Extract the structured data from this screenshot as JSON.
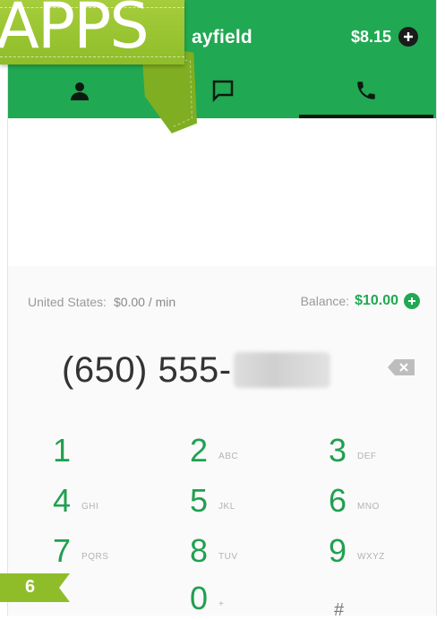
{
  "banner": {
    "label": "APPS"
  },
  "page_number": "6",
  "appbar": {
    "title": "ayfield",
    "credit": "$8.15",
    "accent_color": "#21a852",
    "tabs": [
      {
        "icon": "person-icon",
        "active": false
      },
      {
        "icon": "chat-icon",
        "active": false
      },
      {
        "icon": "phone-icon",
        "active": true
      }
    ]
  },
  "dialer": {
    "rate_label": "United States:",
    "rate_price": "$0.00 / min",
    "balance_label": "Balance:",
    "balance_amount": "$10.00",
    "number_prefix": "(650) 555-",
    "keys": [
      {
        "digit": "1",
        "letters": ""
      },
      {
        "digit": "2",
        "letters": "ABC"
      },
      {
        "digit": "3",
        "letters": "DEF"
      },
      {
        "digit": "4",
        "letters": "GHI"
      },
      {
        "digit": "5",
        "letters": "JKL"
      },
      {
        "digit": "6",
        "letters": "MNO"
      },
      {
        "digit": "7",
        "letters": "PQRS"
      },
      {
        "digit": "8",
        "letters": "TUV"
      },
      {
        "digit": "9",
        "letters": "WXYZ"
      },
      {
        "digit": "0",
        "letters": "+"
      },
      {
        "digit": "#",
        "letters": ""
      }
    ]
  }
}
